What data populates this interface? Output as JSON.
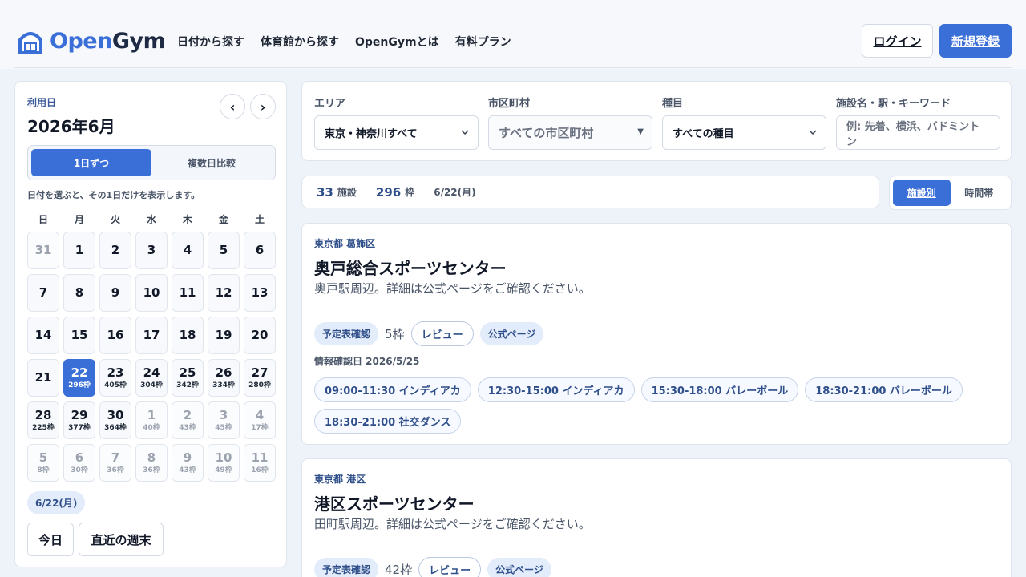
{
  "brand": {
    "open": "Open",
    "gym": "Gym"
  },
  "nav": [
    {
      "label": "日付から探す"
    },
    {
      "label": "体育館から探す"
    },
    {
      "label": "OpenGymとは"
    },
    {
      "label": "有料プラン"
    }
  ],
  "header": {
    "login_label": "ログイン",
    "signup_label": "新規登録"
  },
  "calendar": {
    "label": "利用日",
    "month": "2026年6月",
    "prev": "‹",
    "next": "›",
    "mode_single": "1日ずつ",
    "mode_compare": "複数日比較",
    "hint": "日付を選ぶと、その1日だけを表示します。",
    "weekdays": [
      "日",
      "月",
      "火",
      "水",
      "木",
      "金",
      "土"
    ],
    "days": [
      {
        "n": "31",
        "c": "",
        "state": "muted"
      },
      {
        "n": "1",
        "c": "",
        "state": ""
      },
      {
        "n": "2",
        "c": "",
        "state": ""
      },
      {
        "n": "3",
        "c": "",
        "state": ""
      },
      {
        "n": "4",
        "c": "",
        "state": ""
      },
      {
        "n": "5",
        "c": "",
        "state": ""
      },
      {
        "n": "6",
        "c": "",
        "state": ""
      },
      {
        "n": "7",
        "c": "",
        "state": ""
      },
      {
        "n": "8",
        "c": "",
        "state": ""
      },
      {
        "n": "9",
        "c": "",
        "state": ""
      },
      {
        "n": "10",
        "c": "",
        "state": ""
      },
      {
        "n": "11",
        "c": "",
        "state": ""
      },
      {
        "n": "12",
        "c": "",
        "state": ""
      },
      {
        "n": "13",
        "c": "",
        "state": ""
      },
      {
        "n": "14",
        "c": "",
        "state": ""
      },
      {
        "n": "15",
        "c": "",
        "state": ""
      },
      {
        "n": "16",
        "c": "",
        "state": ""
      },
      {
        "n": "17",
        "c": "",
        "state": ""
      },
      {
        "n": "18",
        "c": "",
        "state": ""
      },
      {
        "n": "19",
        "c": "",
        "state": ""
      },
      {
        "n": "20",
        "c": "",
        "state": ""
      },
      {
        "n": "21",
        "c": "",
        "state": ""
      },
      {
        "n": "22",
        "c": "296枠",
        "state": "sel"
      },
      {
        "n": "23",
        "c": "405枠",
        "state": ""
      },
      {
        "n": "24",
        "c": "304枠",
        "state": ""
      },
      {
        "n": "25",
        "c": "342枠",
        "state": ""
      },
      {
        "n": "26",
        "c": "334枠",
        "state": ""
      },
      {
        "n": "27",
        "c": "280枠",
        "state": ""
      },
      {
        "n": "28",
        "c": "225枠",
        "state": ""
      },
      {
        "n": "29",
        "c": "377枠",
        "state": ""
      },
      {
        "n": "30",
        "c": "364枠",
        "state": ""
      },
      {
        "n": "1",
        "c": "40枠",
        "state": "muted"
      },
      {
        "n": "2",
        "c": "43枠",
        "state": "muted"
      },
      {
        "n": "3",
        "c": "45枠",
        "state": "muted"
      },
      {
        "n": "4",
        "c": "17枠",
        "state": "muted"
      },
      {
        "n": "5",
        "c": "8枠",
        "state": "muted"
      },
      {
        "n": "6",
        "c": "30枠",
        "state": "muted"
      },
      {
        "n": "7",
        "c": "36枠",
        "state": "muted"
      },
      {
        "n": "8",
        "c": "36枠",
        "state": "muted"
      },
      {
        "n": "9",
        "c": "43枠",
        "state": "muted"
      },
      {
        "n": "10",
        "c": "49枠",
        "state": "muted"
      },
      {
        "n": "11",
        "c": "16枠",
        "state": "muted"
      }
    ],
    "selected_chip": "6/22(月)",
    "today_label": "今日",
    "weekend_label": "直近の週末"
  },
  "filters": {
    "area_label": "エリア",
    "area_value": "東京・神奈川すべて",
    "city_label": "市区町村",
    "city_value": "すべての市区町村",
    "sport_label": "種目",
    "sport_value": "すべての種目",
    "keyword_label": "施設名・駅・キーワード",
    "keyword_placeholder": "例: 先着、横浜、バドミントン"
  },
  "summary": {
    "facilities": "33",
    "facilities_unit": "施設",
    "slots": "296",
    "slots_unit": "枠",
    "date": "6/22(月)"
  },
  "view_toggle": {
    "by_facility": "施設別",
    "by_time": "時間帯"
  },
  "facilities": [
    {
      "region": "東京都 葛飾区",
      "name": "奥戸総合スポーツセンター",
      "desc": "奥戸駅周辺。詳細は公式ページをご確認ください。",
      "badge": "予定表確認",
      "slots": "5枠",
      "review": "レビュー",
      "official": "公式ページ",
      "checked": "情報確認日 2026/5/25",
      "times": [
        "09:00-11:30 インディアカ",
        "12:30-15:00 インディアカ",
        "15:30-18:00 バレーボール",
        "18:30-21:00 バレーボール",
        "18:30-21:00 社交ダンス"
      ]
    },
    {
      "region": "東京都 港区",
      "name": "港区スポーツセンター",
      "desc": "田町駅周辺。詳細は公式ページをご確認ください。",
      "badge": "予定表確認",
      "slots": "42枠",
      "review": "レビュー",
      "official": "公式ページ"
    }
  ],
  "colors": {
    "accent": "#3a6fd8",
    "badge_bg": "#e3ecfb",
    "badge_text": "#2f4f8a",
    "page_bg": "#eef2f9"
  }
}
